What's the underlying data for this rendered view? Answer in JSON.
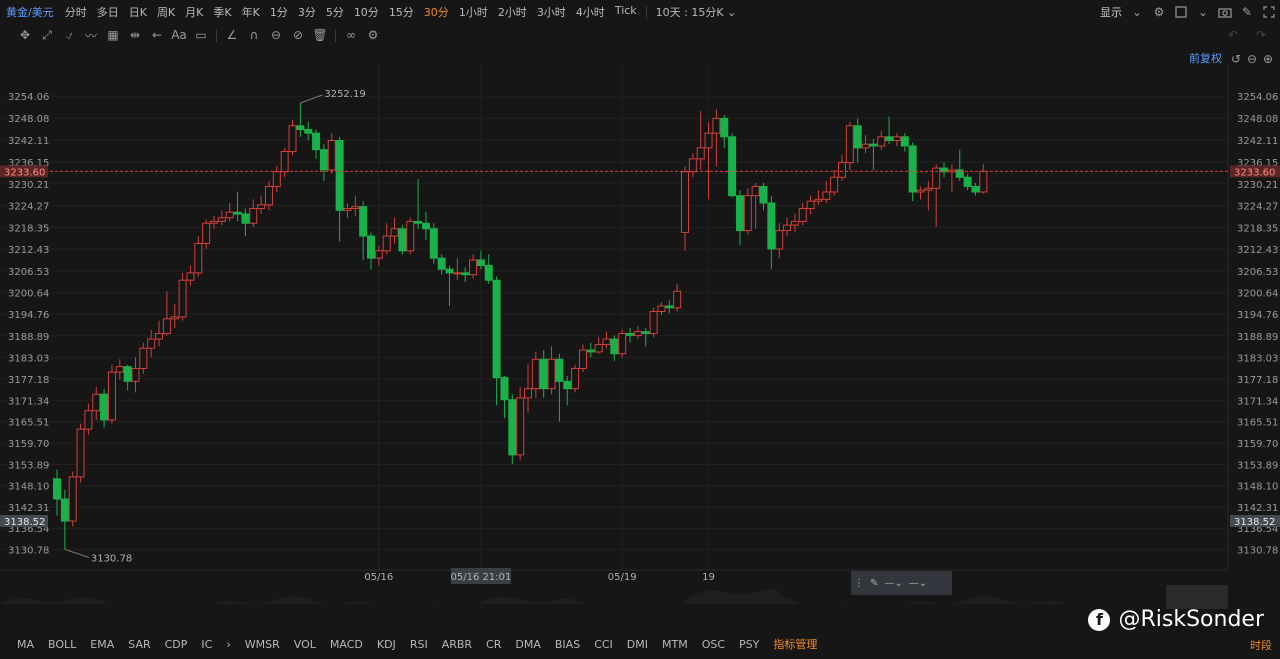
{
  "topbar": {
    "symbol": "黄金/美元",
    "timeframes": [
      "分时",
      "多日",
      "日K",
      "周K",
      "月K",
      "季K",
      "年K",
      "1分",
      "3分",
      "5分",
      "10分",
      "15分",
      "30分",
      "1小时",
      "2小时",
      "3小时",
      "4小时",
      "Tick"
    ],
    "active_timeframe": "30分",
    "range_selector": "10天 : 15分K",
    "display_label": "显示"
  },
  "adjust_label": "前复权",
  "indicators": [
    "MA",
    "BOLL",
    "EMA",
    "SAR",
    "CDP",
    "IC",
    "WMSR",
    "VOL",
    "MACD",
    "KDJ",
    "RSI",
    "ARBR",
    "CR",
    "DMA",
    "BIAS",
    "CCI",
    "DMI",
    "MTM",
    "OSC",
    "PSY"
  ],
  "indicator_manager": "指标管理",
  "period_label": "时段",
  "watermark": "@RiskSonder",
  "colors": {
    "up": "#d2403a",
    "down": "#19b24a",
    "price_line": "#d2403a",
    "accent": "#f08a24",
    "link": "#5a9cff"
  },
  "chart_data": {
    "type": "candlestick",
    "y_ticks": [
      "3254.06",
      "3248.08",
      "3242.11",
      "3236.15",
      "3230.21",
      "3224.27",
      "3218.35",
      "3212.43",
      "3206.53",
      "3200.64",
      "3194.76",
      "3188.89",
      "3183.03",
      "3177.18",
      "3171.34",
      "3165.51",
      "3159.70",
      "3153.89",
      "3148.10",
      "3142.31",
      "3136.54",
      "3130.78"
    ],
    "ylim": [
      3126.0,
      3259.0
    ],
    "current_price": "3233.60",
    "marked_price": "3138.52",
    "high_annotation": "3252.19",
    "low_annotation": "3130.78",
    "x_labels": [
      {
        "label": "05/16",
        "index": 41
      },
      {
        "label": "05/16 21:01",
        "index": 54
      },
      {
        "label": "05/19",
        "index": 72
      },
      {
        "label": "19",
        "index": 83
      }
    ],
    "candles": [
      [
        3150.0,
        3144.5,
        3152.5,
        3140.0
      ],
      [
        3144.5,
        3138.5,
        3147.0,
        3130.8
      ],
      [
        3138.5,
        3150.5,
        3152.0,
        3137.0
      ],
      [
        3150.5,
        3163.5,
        3165.0,
        3149.0
      ],
      [
        3163.5,
        3168.5,
        3170.5,
        3162.0
      ],
      [
        3168.5,
        3173.0,
        3175.0,
        3166.0
      ],
      [
        3173.0,
        3166.0,
        3174.5,
        3164.0
      ],
      [
        3166.0,
        3179.0,
        3181.0,
        3165.0
      ],
      [
        3179.0,
        3180.5,
        3182.5,
        3177.0
      ],
      [
        3180.5,
        3176.5,
        3181.0,
        3174.0
      ],
      [
        3176.5,
        3180.0,
        3183.0,
        3173.5
      ],
      [
        3180.0,
        3185.5,
        3187.0,
        3178.5
      ],
      [
        3185.5,
        3188.0,
        3190.5,
        3183.0
      ],
      [
        3188.0,
        3189.5,
        3193.0,
        3186.0
      ],
      [
        3189.5,
        3193.5,
        3201.0,
        3189.0
      ],
      [
        3193.5,
        3194.0,
        3197.5,
        3191.0
      ],
      [
        3194.0,
        3204.0,
        3206.0,
        3193.0
      ],
      [
        3204.0,
        3206.0,
        3208.0,
        3202.5
      ],
      [
        3206.0,
        3214.0,
        3216.0,
        3205.0
      ],
      [
        3214.0,
        3219.5,
        3220.5,
        3212.5
      ],
      [
        3219.5,
        3220.0,
        3221.5,
        3218.0
      ],
      [
        3220.0,
        3221.0,
        3223.0,
        3219.0
      ],
      [
        3221.0,
        3222.5,
        3225.0,
        3220.0
      ],
      [
        3222.5,
        3222.0,
        3228.0,
        3220.0
      ],
      [
        3222.0,
        3219.5,
        3223.5,
        3216.0
      ],
      [
        3219.5,
        3223.5,
        3226.0,
        3218.5
      ],
      [
        3223.5,
        3224.5,
        3227.0,
        3222.0
      ],
      [
        3224.5,
        3229.5,
        3231.0,
        3223.0
      ],
      [
        3229.5,
        3233.5,
        3235.0,
        3228.0
      ],
      [
        3233.5,
        3239.0,
        3240.0,
        3232.0
      ],
      [
        3239.0,
        3246.0,
        3247.5,
        3238.0
      ],
      [
        3246.0,
        3245.0,
        3252.2,
        3243.0
      ],
      [
        3245.0,
        3244.0,
        3247.0,
        3242.0
      ],
      [
        3244.0,
        3239.5,
        3245.0,
        3237.0
      ],
      [
        3239.5,
        3234.0,
        3241.0,
        3231.0
      ],
      [
        3234.0,
        3242.0,
        3244.0,
        3233.0
      ],
      [
        3242.0,
        3223.0,
        3243.0,
        3214.5
      ],
      [
        3223.0,
        3223.5,
        3225.0,
        3221.0
      ],
      [
        3223.5,
        3224.0,
        3227.0,
        3221.5
      ],
      [
        3224.0,
        3216.0,
        3225.5,
        3209.5
      ],
      [
        3216.0,
        3210.0,
        3217.0,
        3207.0
      ],
      [
        3210.0,
        3212.0,
        3213.5,
        3208.0
      ],
      [
        3212.0,
        3216.0,
        3219.5,
        3211.0
      ],
      [
        3216.0,
        3218.0,
        3221.0,
        3214.0
      ],
      [
        3218.0,
        3212.0,
        3219.0,
        3211.0
      ],
      [
        3212.0,
        3220.0,
        3221.0,
        3211.0
      ],
      [
        3220.0,
        3219.5,
        3231.5,
        3218.0
      ],
      [
        3219.5,
        3218.0,
        3222.5,
        3215.0
      ],
      [
        3218.0,
        3210.0,
        3219.5,
        3208.5
      ],
      [
        3210.0,
        3207.0,
        3211.0,
        3205.5
      ],
      [
        3207.0,
        3206.0,
        3208.0,
        3197.0
      ],
      [
        3206.0,
        3206.0,
        3210.0,
        3204.0
      ],
      [
        3206.0,
        3205.5,
        3207.5,
        3203.5
      ],
      [
        3205.5,
        3209.5,
        3211.0,
        3204.5
      ],
      [
        3209.5,
        3208.0,
        3212.0,
        3207.0
      ],
      [
        3208.0,
        3204.0,
        3211.0,
        3203.0
      ],
      [
        3204.0,
        3177.5,
        3205.0,
        3170.0
      ],
      [
        3177.5,
        3171.5,
        3178.0,
        3166.5
      ],
      [
        3171.5,
        3156.5,
        3173.0,
        3154.0
      ],
      [
        3156.5,
        3172.0,
        3175.0,
        3155.0
      ],
      [
        3172.0,
        3174.5,
        3181.0,
        3168.0
      ],
      [
        3174.5,
        3182.5,
        3184.5,
        3172.0
      ],
      [
        3182.5,
        3174.5,
        3185.0,
        3172.0
      ],
      [
        3174.5,
        3182.5,
        3186.0,
        3173.0
      ],
      [
        3182.5,
        3176.5,
        3184.0,
        3165.5
      ],
      [
        3176.5,
        3174.5,
        3178.0,
        3170.0
      ],
      [
        3174.5,
        3180.0,
        3181.0,
        3173.5
      ],
      [
        3180.0,
        3185.0,
        3186.5,
        3179.0
      ],
      [
        3185.0,
        3184.5,
        3187.0,
        3183.0
      ],
      [
        3184.5,
        3186.5,
        3188.5,
        3184.0
      ],
      [
        3186.5,
        3188.0,
        3190.0,
        3185.5
      ],
      [
        3188.0,
        3184.0,
        3189.0,
        3182.0
      ],
      [
        3184.0,
        3189.5,
        3190.5,
        3183.0
      ],
      [
        3189.5,
        3189.0,
        3191.0,
        3187.0
      ],
      [
        3189.0,
        3190.0,
        3191.5,
        3188.0
      ],
      [
        3190.0,
        3189.5,
        3191.0,
        3186.0
      ],
      [
        3189.5,
        3195.5,
        3196.5,
        3188.5
      ],
      [
        3195.5,
        3197.0,
        3198.0,
        3194.5
      ],
      [
        3197.0,
        3196.5,
        3198.5,
        3195.0
      ],
      [
        3196.5,
        3201.0,
        3203.0,
        3195.5
      ],
      [
        3217.0,
        3233.5,
        3235.0,
        3212.0
      ],
      [
        3233.5,
        3237.0,
        3238.5,
        3232.0
      ],
      [
        3237.0,
        3240.0,
        3250.0,
        3234.0
      ],
      [
        3240.0,
        3244.0,
        3247.0,
        3226.0
      ],
      [
        3244.0,
        3248.0,
        3250.5,
        3235.0
      ],
      [
        3248.0,
        3243.0,
        3249.0,
        3240.0
      ],
      [
        3243.0,
        3227.0,
        3244.0,
        3226.5
      ],
      [
        3227.0,
        3217.5,
        3228.5,
        3213.5
      ],
      [
        3217.5,
        3227.0,
        3229.0,
        3216.5
      ],
      [
        3227.0,
        3229.5,
        3230.5,
        3218.0
      ],
      [
        3229.5,
        3225.0,
        3230.5,
        3223.0
      ],
      [
        3225.0,
        3212.5,
        3227.0,
        3207.0
      ],
      [
        3212.5,
        3217.5,
        3219.5,
        3210.0
      ],
      [
        3217.5,
        3219.0,
        3221.0,
        3216.0
      ],
      [
        3219.0,
        3220.0,
        3222.0,
        3217.0
      ],
      [
        3220.0,
        3223.5,
        3225.0,
        3219.0
      ],
      [
        3223.5,
        3225.5,
        3227.0,
        3222.0
      ],
      [
        3225.5,
        3226.0,
        3228.5,
        3224.5
      ],
      [
        3226.0,
        3228.0,
        3231.0,
        3225.0
      ],
      [
        3228.0,
        3232.0,
        3234.0,
        3227.0
      ],
      [
        3232.0,
        3236.0,
        3238.0,
        3231.0
      ],
      [
        3236.0,
        3246.0,
        3247.0,
        3234.0
      ],
      [
        3246.0,
        3240.0,
        3248.0,
        3236.0
      ],
      [
        3240.0,
        3241.0,
        3243.5,
        3238.5
      ],
      [
        3241.0,
        3240.5,
        3242.5,
        3234.0
      ],
      [
        3240.5,
        3243.0,
        3244.5,
        3239.5
      ],
      [
        3243.0,
        3242.0,
        3248.5,
        3241.0
      ],
      [
        3242.0,
        3243.0,
        3244.0,
        3240.5
      ],
      [
        3243.0,
        3240.5,
        3244.0,
        3239.0
      ],
      [
        3240.5,
        3228.0,
        3241.5,
        3225.5
      ],
      [
        3228.0,
        3228.5,
        3229.5,
        3226.0
      ],
      [
        3228.5,
        3229.0,
        3231.0,
        3223.0
      ],
      [
        3229.0,
        3234.5,
        3235.5,
        3218.5
      ],
      [
        3234.5,
        3233.5,
        3236.0,
        3232.0
      ],
      [
        3233.5,
        3234.0,
        3235.5,
        3228.0
      ],
      [
        3234.0,
        3232.0,
        3239.5,
        3231.0
      ],
      [
        3232.0,
        3229.5,
        3233.0,
        3228.5
      ],
      [
        3229.5,
        3228.0,
        3230.5,
        3227.0
      ],
      [
        3228.0,
        3233.6,
        3235.5,
        3227.5
      ]
    ]
  }
}
